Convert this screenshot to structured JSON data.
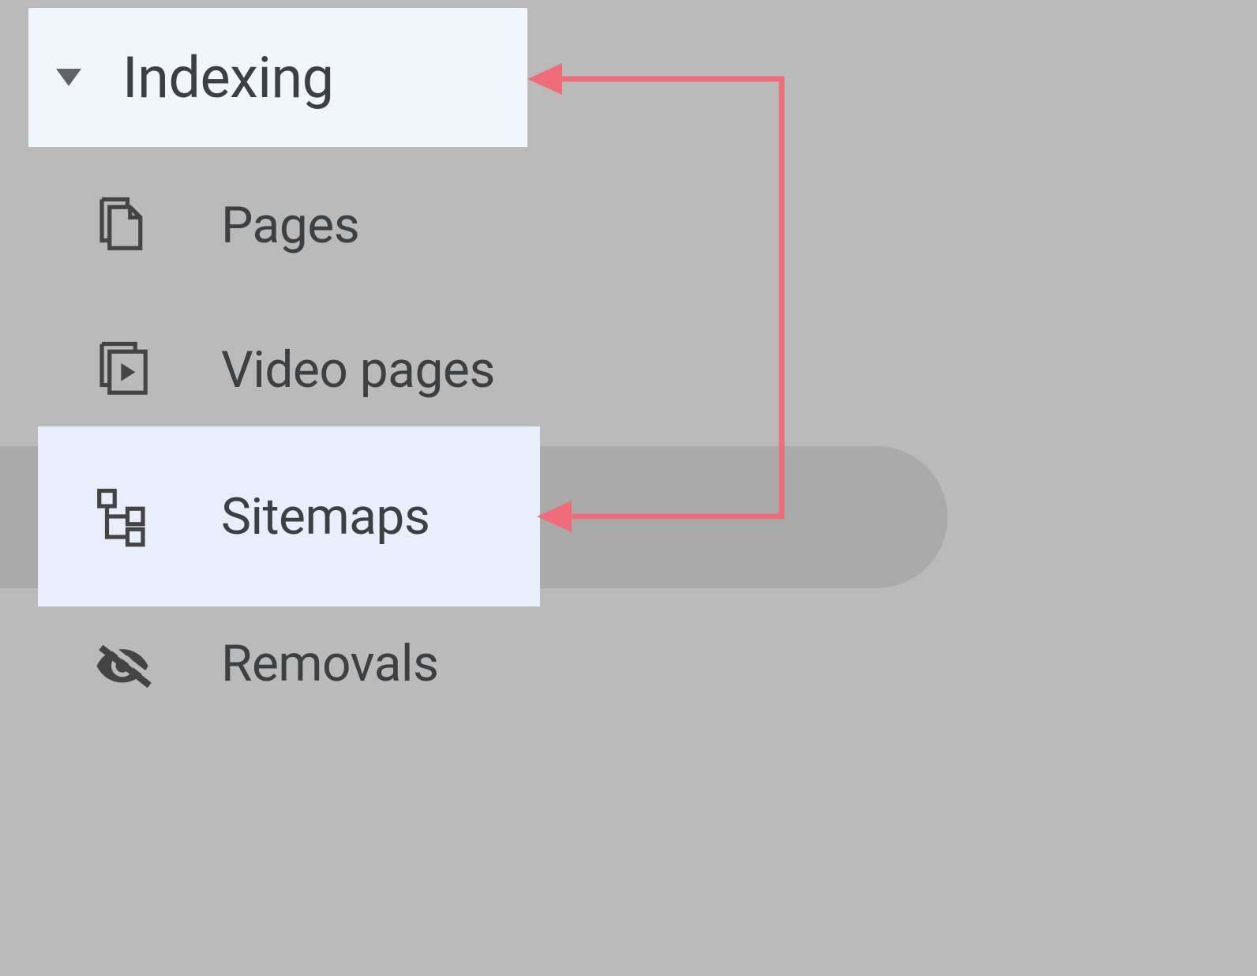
{
  "sidebar": {
    "section_title": "Indexing",
    "items": [
      {
        "label": "Pages"
      },
      {
        "label": "Video pages"
      },
      {
        "label": "Sitemaps"
      },
      {
        "label": "Removals"
      }
    ]
  },
  "annotation": {
    "arrow_color": "#ee6d78"
  }
}
